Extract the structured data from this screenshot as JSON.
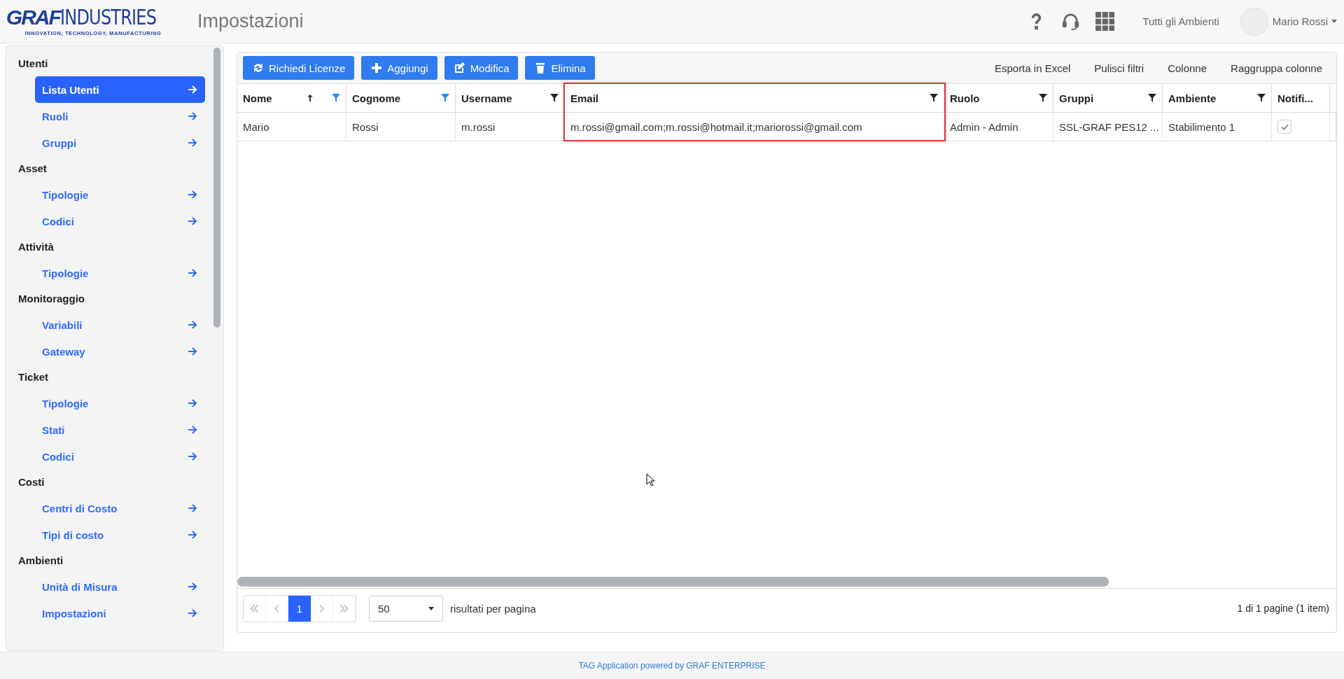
{
  "header": {
    "logo_word_bold": "GRAF",
    "logo_word_light": "INDUSTRIES",
    "logo_tagline": "INNOVATION, TECHNOLOGY, MANUFACTURING",
    "page_title": "Impostazioni",
    "environment": "Tutti gli Ambienti",
    "user": "Mario Rossi"
  },
  "sidebar": {
    "sections": [
      {
        "title": "Utenti",
        "items": [
          {
            "label": "Lista Utenti",
            "selected": true
          },
          {
            "label": "Ruoli",
            "selected": false
          },
          {
            "label": "Gruppi",
            "selected": false
          }
        ]
      },
      {
        "title": "Asset",
        "items": [
          {
            "label": "Tipologie",
            "selected": false
          },
          {
            "label": "Codici",
            "selected": false
          }
        ]
      },
      {
        "title": "Attività",
        "items": [
          {
            "label": "Tipologie",
            "selected": false
          }
        ]
      },
      {
        "title": "Monitoraggio",
        "items": [
          {
            "label": "Variabili",
            "selected": false
          },
          {
            "label": "Gateway",
            "selected": false
          }
        ]
      },
      {
        "title": "Ticket",
        "items": [
          {
            "label": "Tipologie",
            "selected": false
          },
          {
            "label": "Stati",
            "selected": false
          },
          {
            "label": "Codici",
            "selected": false
          }
        ]
      },
      {
        "title": "Costi",
        "items": [
          {
            "label": "Centri di Costo",
            "selected": false
          },
          {
            "label": "Tipi di costo",
            "selected": false
          }
        ]
      },
      {
        "title": "Ambienti",
        "items": [
          {
            "label": "Unità di Misura",
            "selected": false
          },
          {
            "label": "Impostazioni",
            "selected": false
          }
        ]
      }
    ]
  },
  "toolbar": {
    "buttons": [
      {
        "label": "Richiedi Licenze",
        "kind": "refresh"
      },
      {
        "label": "Aggiungi",
        "kind": "add"
      },
      {
        "label": "Modifica",
        "kind": "edit"
      },
      {
        "label": "Elimina",
        "kind": "delete"
      }
    ],
    "links": [
      "Esporta in Excel",
      "Pulisci filtri",
      "Colonne",
      "Raggruppa colonne"
    ]
  },
  "table": {
    "columns": [
      {
        "label": "Nome",
        "sorted": true,
        "filter_active": true
      },
      {
        "label": "Cognome",
        "sorted": false,
        "filter_active": true
      },
      {
        "label": "Username",
        "sorted": false,
        "filter_active": false
      },
      {
        "label": "Email",
        "sorted": false,
        "filter_active": false,
        "highlighted": true
      },
      {
        "label": "Ruolo",
        "sorted": false,
        "filter_active": false
      },
      {
        "label": "Gruppi",
        "sorted": false,
        "filter_active": false
      },
      {
        "label": "Ambiente",
        "sorted": false,
        "filter_active": false
      },
      {
        "label": "Notifi...",
        "sorted": false
      }
    ],
    "rows": [
      {
        "cells": [
          "Mario",
          "Rossi",
          "m.rossi",
          "m.rossi@gmail.com;m.rossi@hotmail.it;mariorossi@gmail.com",
          "Admin - Admin",
          "SSL-GRAF PES12 ...",
          "Stabilimento 1"
        ],
        "notify_checked": true
      }
    ]
  },
  "pagination": {
    "pages": [
      {
        "label": "1",
        "selected": true
      }
    ],
    "page_size": "50",
    "page_size_label": "risultati per pagina",
    "summary": "1 di 1 pagine (1 item)"
  },
  "footer": "TAG Application powered by GRAF ENTERPRISE"
}
